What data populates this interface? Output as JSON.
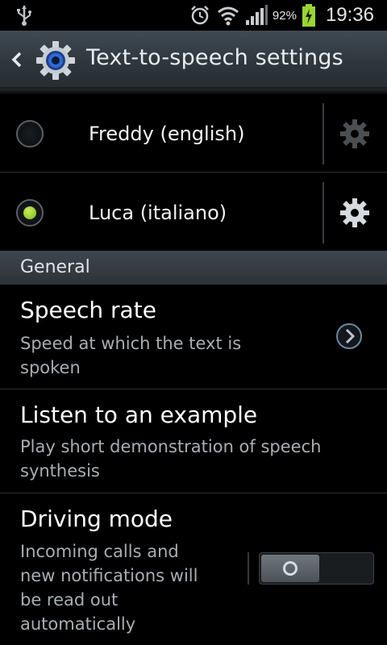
{
  "status_bar": {
    "battery_percent": "92%",
    "time": "19:36",
    "icons": [
      "usb-icon",
      "alarm-icon",
      "wifi-icon",
      "signal-icon",
      "battery-charging-icon"
    ]
  },
  "action_bar": {
    "title": "Text-to-speech settings",
    "back_icon": "chevron-left-icon",
    "app_icon": "settings-gear-icon"
  },
  "engines": [
    {
      "label": "Freddy (english)",
      "selected": false
    },
    {
      "label": "Luca (italiano)",
      "selected": true
    }
  ],
  "section": {
    "title": "General"
  },
  "preferences": {
    "speech_rate": {
      "title": "Speech rate",
      "summary_line1": "Speed at which the text is",
      "summary_line2": "spoken"
    },
    "listen_example": {
      "title": "Listen to an example",
      "summary_line1": "Play short demonstration of speech",
      "summary_line2": "synthesis"
    },
    "driving_mode": {
      "title": "Driving mode",
      "summary_line1": "Incoming calls and",
      "summary_line2": "new notifications will",
      "summary_line3": "be read out",
      "summary_line4": "automatically",
      "enabled": false
    }
  },
  "colors": {
    "accent_green": "#9ad530",
    "header_bg": "#2e363c"
  }
}
